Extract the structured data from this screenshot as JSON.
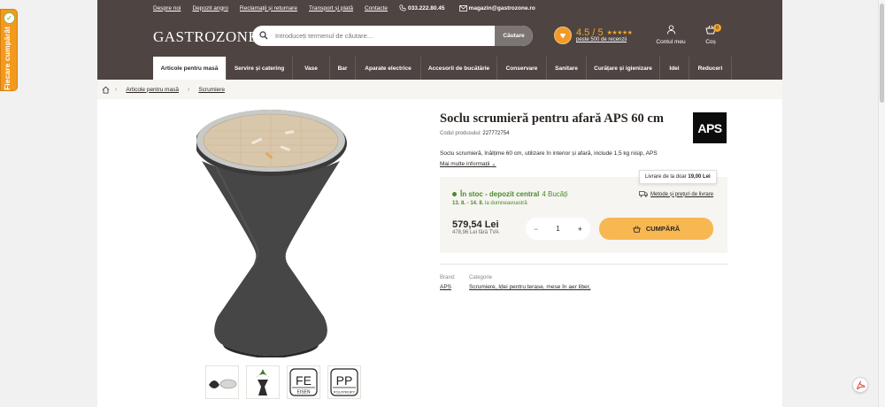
{
  "loyalty_tab": {
    "label": "Fiecare cumpărătorul"
  },
  "topbar": {
    "links": [
      "Despre noi",
      "Depozit angro",
      "Reclamații și returnare",
      "Transport și plată",
      "Contacte"
    ],
    "phone": "033.222.80.45",
    "email": "magazin@gastrozone.ro"
  },
  "header": {
    "logo": "GASTROZONE",
    "search_placeholder": "Introduceți termenul de căutare...",
    "search_button": "Căutare",
    "rating": "4.5 / 5",
    "stars": "★★★★★",
    "reviews": "peste 500 de recenzii",
    "account_label": "Contul meu",
    "cart_label": "Coș",
    "cart_count": "0"
  },
  "nav": [
    "Articole pentru masă",
    "Servire și catering",
    "Vase",
    "Bar",
    "Aparate electrice",
    "Accesorii de bucătărie",
    "Conservare",
    "Sanitare",
    "Curățare și igienizare",
    "Idei",
    "Reduceri"
  ],
  "breadcrumb": {
    "items": [
      "Articole pentru masă",
      "Scrumiere"
    ]
  },
  "product": {
    "title": "Soclu scrumieră pentru afară APS 60 cm",
    "code_label": "Codul produsului:",
    "code": "227772754",
    "brand_logo": "APS",
    "description": "Soclu scrumieră, înălțime 60 cm, utilizare în interior și afară, include 1,5 kg nisip, APS",
    "more_info": "Mai multe informații",
    "stock": "În stoc - depozit central",
    "stock_qty": "4 Bucăți",
    "delivery_dates": "13. 8. - 14. 8.",
    "delivery_suffix": "la dumneavoastră",
    "tooltip_prefix": "Livrare de la doar",
    "tooltip_price": "19,00 Lei",
    "shipping_link": "Metode și prețuri de livrare",
    "price": "579,54 Lei",
    "price_net": "478,96 Lei fără TVA",
    "quantity": "1",
    "minus": "−",
    "plus": "+",
    "buy_label": "CUMPĂRĂ",
    "brand_label": "Brand:",
    "brand_value": "APS",
    "category_label": "Categorie",
    "category_value": "Scrumiere, Idei pentru terase, mese în aer liber,"
  },
  "thumbnails": {
    "fe_top": "FE",
    "fe_bottom": "EISEN",
    "pp_top": "PP",
    "pp_bottom": "POLYPROPY"
  },
  "colors": {
    "header_bg": "#4e4442",
    "accent": "#f7b852",
    "stock_green": "#4a8a2a",
    "loyalty_orange": "#f39a1e"
  }
}
